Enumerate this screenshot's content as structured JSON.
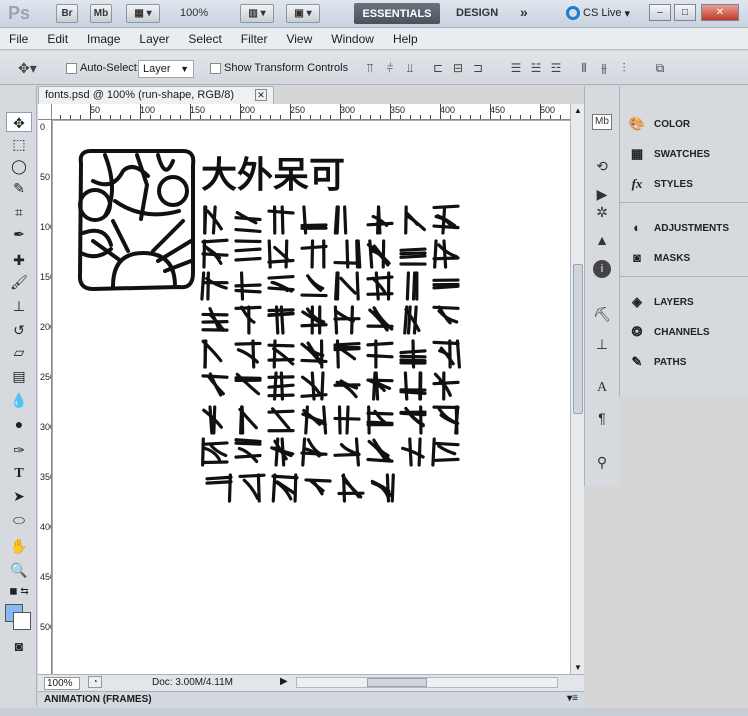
{
  "app": {
    "logo": "Ps",
    "btn_br": "Br",
    "btn_mb": "Mb",
    "zoom": "100%",
    "workspace_active": "ESSENTIALS",
    "workspace_other": "DESIGN",
    "more": "»",
    "cslive": "CS Live",
    "win_min": "–",
    "win_max": "□",
    "win_close": "✕"
  },
  "menu": [
    "File",
    "Edit",
    "Image",
    "Layer",
    "Select",
    "Filter",
    "View",
    "Window",
    "Help"
  ],
  "options": {
    "auto_select_label": "Auto-Select:",
    "auto_select_value": "Layer",
    "show_transform_label": "Show Transform Controls"
  },
  "document": {
    "tab_title": "fonts.psd @ 100% (run-shape, RGB/8)",
    "zoom": "100%",
    "doc_info": "Doc: 3.00M/4.11M",
    "ruler_h": [
      "0",
      "50",
      "100",
      "150",
      "200",
      "250",
      "300",
      "350",
      "400",
      "450",
      "500"
    ],
    "ruler_v": [
      "0",
      "50",
      "100",
      "150",
      "200",
      "250",
      "300",
      "350",
      "400",
      "450",
      "500"
    ],
    "heading_glyphs": "大外呆可"
  },
  "bottom_panel": {
    "label": "ANIMATION (FRAMES)"
  },
  "panels": {
    "group1": [
      "COLOR",
      "SWATCHES",
      "STYLES"
    ],
    "group2": [
      "ADJUSTMENTS",
      "MASKS"
    ],
    "group3": [
      "LAYERS",
      "CHANNELS",
      "PATHS"
    ]
  },
  "icons": {
    "color": "palette-icon",
    "swatches": "grid-icon",
    "styles": "fx-icon"
  }
}
